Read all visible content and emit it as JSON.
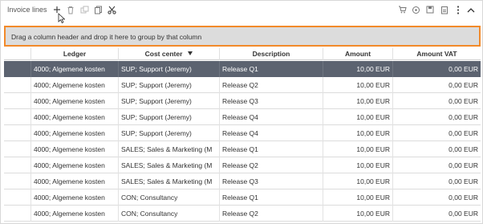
{
  "panel": {
    "title": "Invoice lines"
  },
  "group_bar": {
    "text": "Drag a column header and drop it here to group by that column"
  },
  "columns": [
    "Ledger",
    "Cost center",
    "Description",
    "Amount",
    "Amount VAT"
  ],
  "rows": [
    {
      "ledger": "4000; Algemene kosten",
      "cost_center": "SUP; Support (Jeremy)",
      "description": "Release Q1",
      "amount": "10,00 EUR",
      "amount_vat": "0,00 EUR",
      "selected": true
    },
    {
      "ledger": "4000; Algemene kosten",
      "cost_center": "SUP; Support (Jeremy)",
      "description": "Release Q2",
      "amount": "10,00 EUR",
      "amount_vat": "0,00 EUR"
    },
    {
      "ledger": "4000; Algemene kosten",
      "cost_center": "SUP; Support (Jeremy)",
      "description": "Release Q3",
      "amount": "10,00 EUR",
      "amount_vat": "0,00 EUR"
    },
    {
      "ledger": "4000; Algemene kosten",
      "cost_center": "SUP; Support (Jeremy)",
      "description": "Release Q4",
      "amount": "10,00 EUR",
      "amount_vat": "0,00 EUR"
    },
    {
      "ledger": "4000; Algemene kosten",
      "cost_center": "SUP; Support (Jeremy)",
      "description": "Release Q4",
      "amount": "10,00 EUR",
      "amount_vat": "0,00 EUR"
    },
    {
      "ledger": "4000; Algemene kosten",
      "cost_center": "SALES; Sales & Marketing (M",
      "description": "Release Q1",
      "amount": "10,00 EUR",
      "amount_vat": "0,00 EUR"
    },
    {
      "ledger": "4000; Algemene kosten",
      "cost_center": "SALES; Sales & Marketing (M",
      "description": "Release Q2",
      "amount": "10,00 EUR",
      "amount_vat": "0,00 EUR"
    },
    {
      "ledger": "4000; Algemene kosten",
      "cost_center": "SALES; Sales & Marketing (M",
      "description": "Release Q3",
      "amount": "10,00 EUR",
      "amount_vat": "0,00 EUR"
    },
    {
      "ledger": "4000; Algemene kosten",
      "cost_center": "CON; Consultancy",
      "description": "Release Q1",
      "amount": "10,00 EUR",
      "amount_vat": "0,00 EUR"
    },
    {
      "ledger": "4000; Algemene kosten",
      "cost_center": "CON; Consultancy",
      "description": "Release Q2",
      "amount": "10,00 EUR",
      "amount_vat": "0,00 EUR"
    }
  ],
  "colors": {
    "accent_border": "#f28a2a",
    "selected_row": "#5c6370",
    "group_bar_bg": "#dcdcdc"
  },
  "icons": {
    "left_toolbar": [
      "plus-icon",
      "trash-icon",
      "copy-disabled-icon",
      "duplicate-icon",
      "scissors-icon"
    ],
    "right_toolbar": [
      "cart-icon",
      "network-icon",
      "save-icon",
      "export-icon",
      "more-vertical-icon",
      "chevron-up-icon"
    ]
  }
}
